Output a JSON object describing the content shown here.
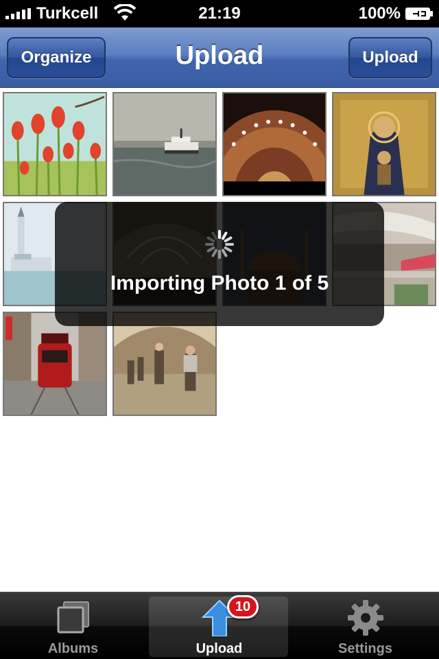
{
  "status_bar": {
    "carrier": "Turkcell",
    "time": "21:19",
    "battery": "100%"
  },
  "nav": {
    "title": "Upload",
    "left_button": "Organize",
    "right_button": "Upload"
  },
  "photos": [
    {
      "subject": "tulips"
    },
    {
      "subject": "ferry at sea"
    },
    {
      "subject": "mosque dome interior"
    },
    {
      "subject": "byzantine mosaic"
    },
    {
      "subject": "maiden's tower"
    },
    {
      "subject": "grand bazaar arches"
    },
    {
      "subject": "mosque at dusk"
    },
    {
      "subject": "shopping mall interior"
    },
    {
      "subject": "red tram on street"
    },
    {
      "subject": "bazaar crowd"
    }
  ],
  "hud": {
    "message": "Importing Photo 1 of 5"
  },
  "tab_bar": {
    "tabs": [
      {
        "label": "Albums",
        "icon": "albums-icon"
      },
      {
        "label": "Upload",
        "icon": "upload-arrow-icon",
        "badge": "10",
        "active": true
      },
      {
        "label": "Settings",
        "icon": "gear-icon"
      }
    ]
  },
  "colors": {
    "nav_blue": "#3f64ad",
    "badge_red": "#d8131b",
    "upload_blue": "#3a8fe0"
  }
}
